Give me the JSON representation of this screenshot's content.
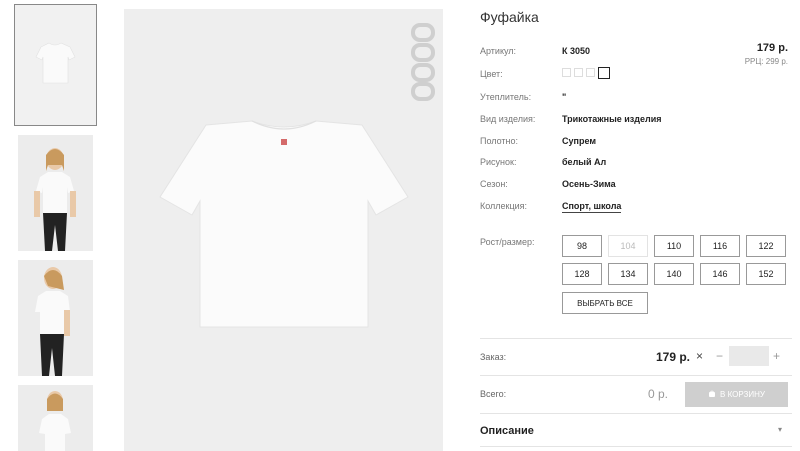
{
  "product": {
    "title": "Фуфайка",
    "price": "179 р.",
    "rrp": "РРЦ: 299 р."
  },
  "attributes": [
    {
      "label": "Артикул:",
      "value": "К 3050"
    },
    {
      "label": "Цвет:",
      "value": ""
    },
    {
      "label": "Утеплитель:",
      "value": "\""
    },
    {
      "label": "Вид изделия:",
      "value": "Трикотажные изделия"
    },
    {
      "label": "Полотно:",
      "value": "Супрем"
    },
    {
      "label": "Рисунок:",
      "value": "белый Ал"
    },
    {
      "label": "Сезон:",
      "value": "Осень-Зима"
    },
    {
      "label": "Коллекция:",
      "value": "Спорт, школа"
    }
  ],
  "sizes": {
    "label": "Рост/размер:",
    "items": [
      "98",
      "104",
      "110",
      "116",
      "122",
      "128",
      "134",
      "140",
      "146",
      "152"
    ],
    "disabled": [
      "104"
    ],
    "select_all": "ВЫБРАТЬ ВСЕ"
  },
  "order": {
    "label": "Заказ:",
    "price": "179 р.",
    "times": "×",
    "minus": "−",
    "plus": "+"
  },
  "total": {
    "label": "Всего:",
    "value": "0 р.",
    "cart_button": "В КОРЗИНУ"
  },
  "description": {
    "label": "Описание",
    "arrow": "▾"
  },
  "icons": {
    "cart": "cart-icon",
    "brand_logo": "brand-logo"
  }
}
